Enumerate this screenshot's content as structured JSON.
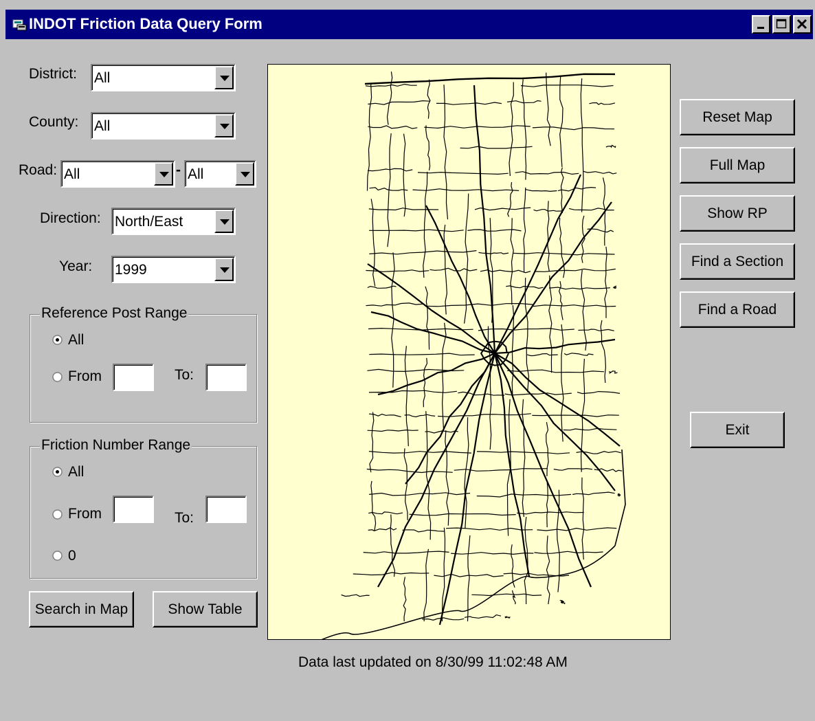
{
  "window": {
    "title": "INDOT Friction Data Query Form",
    "icon": "app-icon"
  },
  "titlebar_buttons": {
    "minimize": "minimize-icon",
    "maximize": "maximize-icon",
    "close": "close-icon"
  },
  "filters": {
    "district_label": "District:",
    "district_value": "All",
    "county_label": "County:",
    "county_value": "All",
    "road_label": "Road:",
    "road_value": "All",
    "road_dash": "-",
    "road_value2": "All",
    "direction_label": "Direction:",
    "direction_value": "North/East",
    "year_label": "Year:",
    "year_value": "1999"
  },
  "reference_post": {
    "title": "Reference Post Range",
    "all_label": "All",
    "from_label": "From",
    "to_label": "To:",
    "selected": "All"
  },
  "friction_number": {
    "title": "Friction Number Range",
    "all_label": "All",
    "from_label": "From",
    "to_label": "To:",
    "zero_label": "0",
    "selected": "All"
  },
  "buttons": {
    "search_in_map": "Search in Map",
    "show_table": "Show Table",
    "reset_map": "Reset Map",
    "full_map": "Full Map",
    "show_rp": "Show RP",
    "find_section": "Find a Section",
    "find_road": "Find a Road",
    "exit": "Exit"
  },
  "map": {
    "background": "#ffffd0",
    "line_color": "#000000"
  },
  "status": {
    "updated": "Data last updated on 8/30/99 11:02:48 AM"
  }
}
